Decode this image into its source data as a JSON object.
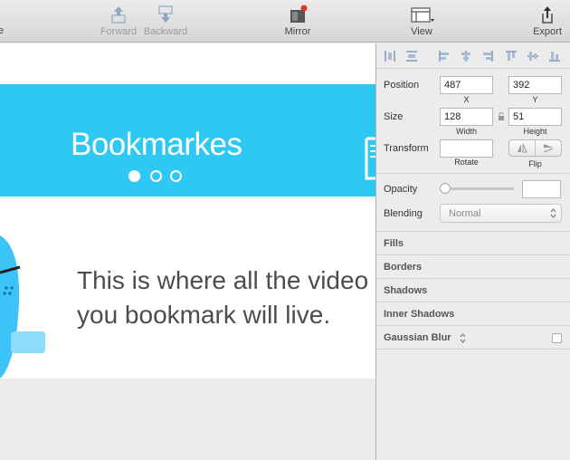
{
  "toolbar": {
    "partial_label": "e",
    "forward_label": "Forward",
    "backward_label": "Backward",
    "mirror_label": "Mirror",
    "view_label": "View",
    "export_label": "Export"
  },
  "canvas": {
    "banner_title": "Bookmarkes",
    "body_line1": "This is where all the video",
    "body_line2": "you bookmark will live."
  },
  "inspector": {
    "position_label": "Position",
    "x_value": "487",
    "x_label": "X",
    "y_value": "392",
    "y_label": "Y",
    "size_label": "Size",
    "width_value": "128",
    "width_label": "Width",
    "height_value": "51",
    "height_label": "Height",
    "transform_label": "Transform",
    "rotate_label": "Rotate",
    "flip_label": "Flip",
    "opacity_label": "Opacity",
    "blending_label": "Blending",
    "blending_value": "Normal",
    "sections": {
      "fills": "Fills",
      "borders": "Borders",
      "shadows": "Shadows",
      "inner_shadows": "Inner Shadows",
      "gaussian_blur": "Gaussian Blur"
    }
  },
  "colors": {
    "banner": "#2ec8f5",
    "mascot": "#3cc3f7",
    "mirror_badge": "#e8322c"
  }
}
